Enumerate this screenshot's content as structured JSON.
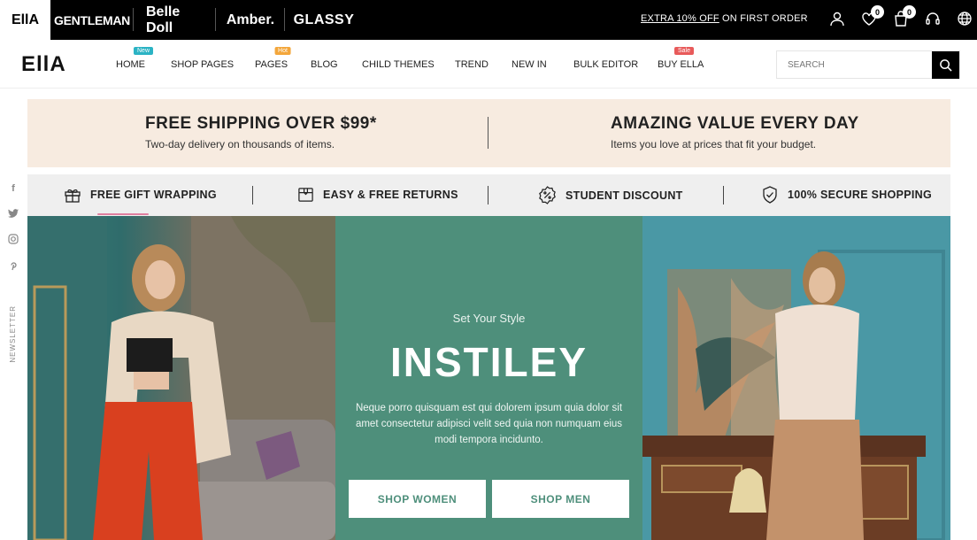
{
  "topbar": {
    "brands": [
      "EllA",
      "GENTLEMAN",
      "Belle Doll",
      "Amber.",
      "GLASSY"
    ],
    "promo_link": "EXTRA 10% OFF",
    "promo_rest": " ON FIRST ORDER",
    "wishlist_count": "0",
    "cart_count": "0",
    "icons": [
      "user-icon",
      "heart-icon",
      "bag-icon",
      "headset-icon",
      "globe-icon"
    ]
  },
  "nav": {
    "logo": "EllA",
    "items": [
      {
        "label": "HOME",
        "tag": "New",
        "tag_color": "#2bb3c4"
      },
      {
        "label": "SHOP PAGES"
      },
      {
        "label": "PAGES",
        "tag": "Hot",
        "tag_color": "#f3a63b"
      },
      {
        "label": "BLOG"
      },
      {
        "label": "CHILD THEMES"
      },
      {
        "label": "TREND"
      },
      {
        "label": "NEW IN"
      },
      {
        "label": "BULK EDITOR"
      },
      {
        "label": "BUY ELLA",
        "tag": "Sale",
        "tag_color": "#e85a5a"
      }
    ],
    "search_placeholder": "SEARCH"
  },
  "shipping": {
    "left_title": "FREE SHIPPING OVER $99*",
    "left_sub": "Two-day delivery on thousands of items.",
    "right_title": "AMAZING VALUE EVERY DAY",
    "right_sub": "Items you love at prices that fit your budget."
  },
  "features": [
    {
      "label": "FREE GIFT WRAPPING",
      "icon": "gift-icon"
    },
    {
      "label": "EASY & FREE RETURNS",
      "icon": "box-icon"
    },
    {
      "label": "STUDENT DISCOUNT",
      "icon": "percent-badge-icon"
    },
    {
      "label": "100% SECURE SHOPPING",
      "icon": "shield-icon"
    }
  ],
  "social": {
    "icons": [
      "facebook-icon",
      "twitter-icon",
      "instagram-icon",
      "pinterest-icon"
    ],
    "newsletter": "NEWSLETTER"
  },
  "hero": {
    "subtitle": "Set Your Style",
    "title": "INSTILEY",
    "description": "Neque porro quisquam est qui dolorem ipsum quia dolor sit amet consectetur adipisci velit sed quia non numquam eius modi tempora incidunto.",
    "button_women": "SHOP WOMEN",
    "button_men": "SHOP MEN"
  },
  "colors": {
    "accent_green": "#4e8f7b",
    "banner_beige": "#f7ebe0"
  }
}
